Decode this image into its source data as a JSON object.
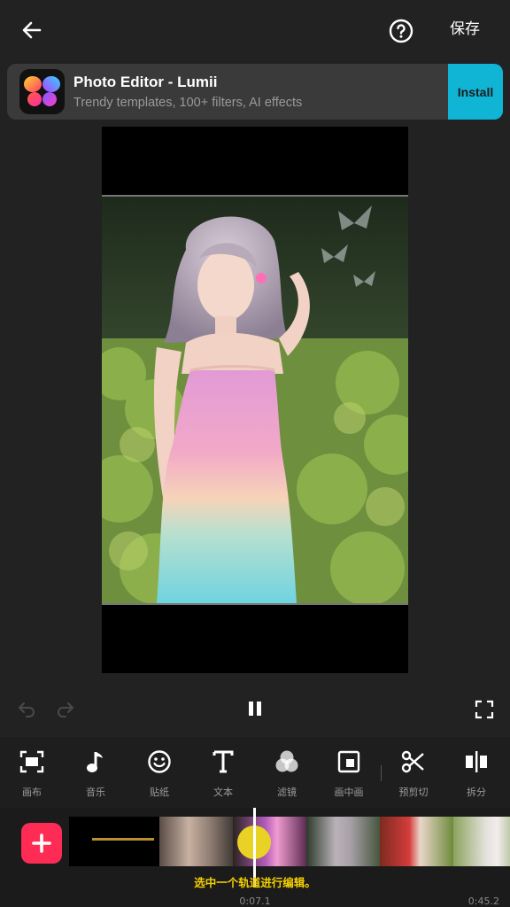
{
  "header": {
    "save_label": "保存"
  },
  "ad": {
    "title": "Photo Editor - Lumii",
    "subtitle": "Trendy templates, 100+ filters, AI effects",
    "install_label": "Install",
    "install_color": "#10b4d4"
  },
  "toolbar": {
    "tools": [
      {
        "label": "画布",
        "icon": "canvas-icon"
      },
      {
        "label": "音乐",
        "icon": "music-note-icon"
      },
      {
        "label": "贴纸",
        "icon": "sticker-smiley-icon"
      },
      {
        "label": "文本",
        "icon": "text-icon"
      },
      {
        "label": "滤镜",
        "icon": "filter-icon"
      },
      {
        "label": "画中画",
        "icon": "picture-in-picture-icon"
      },
      {
        "label": "预剪切",
        "icon": "scissors-icon"
      },
      {
        "label": "拆分",
        "icon": "split-icon"
      }
    ]
  },
  "timeline": {
    "hint": "选中一个轨道进行编辑。",
    "current_time": "0:07.1",
    "total_time": "0:45.2",
    "accent": "#fe2c55",
    "hint_color": "#f5d000"
  }
}
